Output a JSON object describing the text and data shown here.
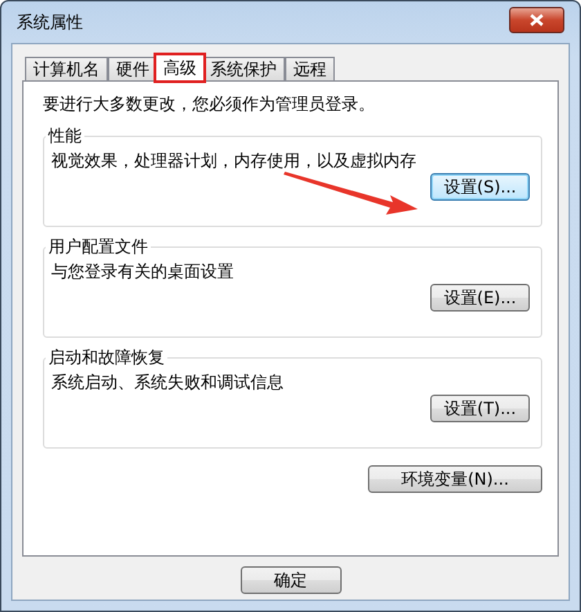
{
  "window": {
    "title": "系统属性"
  },
  "tabs": [
    {
      "label": "计算机名",
      "selected": false,
      "highlighted": false
    },
    {
      "label": "硬件",
      "selected": false,
      "highlighted": false
    },
    {
      "label": "高级",
      "selected": true,
      "highlighted": true
    },
    {
      "label": "系统保护",
      "selected": false,
      "highlighted": false
    },
    {
      "label": "远程",
      "selected": false,
      "highlighted": false
    }
  ],
  "notice": "要进行大多数更改，您必须作为管理员登录。",
  "groups": [
    {
      "title": "性能",
      "description": "视觉效果，处理器计划，内存使用，以及虚拟内存",
      "button": {
        "label": "设置(S)...",
        "focused": true,
        "arrow": true
      }
    },
    {
      "title": "用户配置文件",
      "description": "与您登录有关的桌面设置",
      "button": {
        "label": "设置(E)...",
        "focused": false,
        "arrow": false
      }
    },
    {
      "title": "启动和故障恢复",
      "description": "系统启动、系统失败和调试信息",
      "button": {
        "label": "设置(T)...",
        "focused": false,
        "arrow": false
      }
    }
  ],
  "env_button": {
    "label": "环境变量(N)..."
  },
  "footer_buttons": [
    "确定"
  ]
}
